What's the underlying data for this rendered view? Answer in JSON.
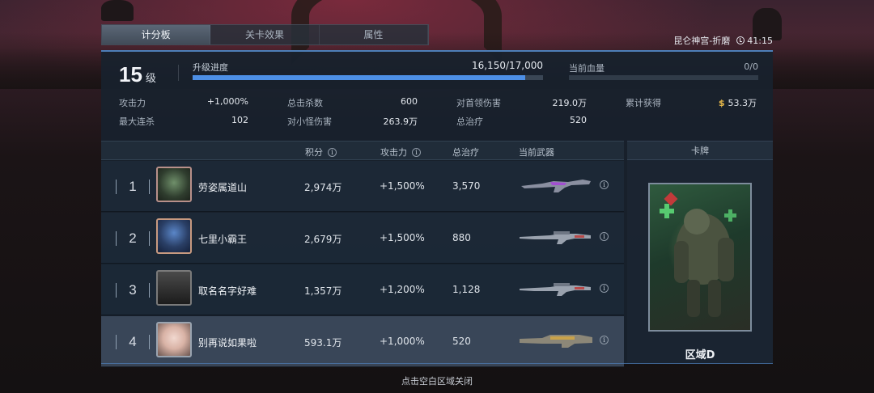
{
  "tabs": [
    {
      "label": "计分板",
      "active": true
    },
    {
      "label": "关卡效果",
      "active": false
    },
    {
      "label": "属性",
      "active": false
    }
  ],
  "map_info": {
    "location": "昆仑神宫-折磨",
    "timer": "41:15"
  },
  "level": {
    "value": "15",
    "unit": "级"
  },
  "progress": {
    "label": "升级进度",
    "value": "16,150/17,000",
    "fraction": 0.95
  },
  "hp": {
    "label": "当前血量",
    "value": "0/0",
    "fraction": 0
  },
  "stats": {
    "attack": {
      "label": "攻击力",
      "value": "+1,000%"
    },
    "kills": {
      "label": "总击杀数",
      "value": "600"
    },
    "boss_damage": {
      "label": "对首领伤害",
      "value": "219.0万"
    },
    "earned": {
      "label": "累计获得",
      "value": "53.3万",
      "currency_icon": "$"
    },
    "max_combo": {
      "label": "最大连杀",
      "value": "102"
    },
    "minion_damage": {
      "label": "对小怪伤害",
      "value": "263.9万"
    },
    "heal": {
      "label": "总治疗",
      "value": "520"
    }
  },
  "table": {
    "headers": {
      "score": "积分",
      "attack": "攻击力",
      "heal": "总治疗",
      "weapon": "当前武器",
      "card": "卡牌"
    },
    "rows": [
      {
        "rank": "1",
        "name": "劳姿属道山",
        "score": "2,974万",
        "attack": "+1,500%",
        "heal": "3,570",
        "weapon": "purple-rifle-icon"
      },
      {
        "rank": "2",
        "name": "七里小霸王",
        "score": "2,679万",
        "attack": "+1,500%",
        "heal": "880",
        "weapon": "sniper-rifle-icon"
      },
      {
        "rank": "3",
        "name": "取名名字好难",
        "score": "1,357万",
        "attack": "+1,200%",
        "heal": "1,128",
        "weapon": "sniper-rifle-icon"
      },
      {
        "rank": "4",
        "name": "别再说如果啦",
        "score": "593.1万",
        "attack": "+1,000%",
        "heal": "520",
        "weapon": "heavy-rifle-icon"
      }
    ]
  },
  "card": {
    "name": "区域D"
  },
  "footer": {
    "hint": "点击空白区域关闭"
  },
  "colors": {
    "accent": "#4e7fb8",
    "progress": "#4d8fe6",
    "gold": "#e6b84a"
  }
}
